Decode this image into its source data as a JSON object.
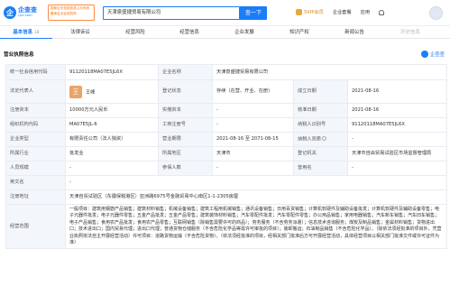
{
  "header": {
    "logo_mark": "企",
    "logo_text": "企查查",
    "logo_sub": "Qcc.com",
    "official_badge": "国家企业信用信息公示系统 备案企业征信机构",
    "search_value": "天津泉盛捷贸易有限公司",
    "search_button": "查一下",
    "links": {
      "svip": "SVIP会员",
      "enterprise": "企业套餐",
      "app": "应用",
      "notifications": ""
    }
  },
  "tabs": [
    {
      "label": "基本信息",
      "count": "18",
      "active": true
    },
    {
      "label": "法律诉讼",
      "count": "",
      "active": false
    },
    {
      "label": "经营风险",
      "count": "",
      "active": false
    },
    {
      "label": "经营信息",
      "count": "",
      "active": false
    },
    {
      "label": "企业发展",
      "count": "",
      "active": false
    },
    {
      "label": "知识产权",
      "count": "",
      "active": false
    },
    {
      "label": "新闻公告",
      "count": "",
      "active": false
    },
    {
      "label": "历史信息",
      "count": "",
      "active": false
    }
  ],
  "section": {
    "title": "营业执照信息",
    "source": "企查查"
  },
  "info": {
    "credit_code_label": "统一社会信用代码",
    "credit_code": "91120118MA07E5JL6X",
    "company_name_label": "企业名称",
    "company_name": "天津泉盛捷贸易有限公司",
    "legal_rep_label": "法定代表人",
    "legal_rep_avatar": "王",
    "legal_rep": "王峰",
    "status_label": "登记状态",
    "status": "存续（在营、开业、在册）",
    "established_label": "成立日期",
    "established": "2021-08-16",
    "reg_capital_label": "注册资本",
    "reg_capital": "10000万元人民币",
    "paid_capital_label": "实缴资本",
    "paid_capital": "-",
    "approval_date_label": "核准日期",
    "approval_date": "2021-08-16",
    "org_code_label": "组织机构代码",
    "org_code": "MA07E5JL-6",
    "biz_reg_no_label": "工商注册号",
    "biz_reg_no": "-",
    "taxpayer_id_label": "纳税人识别号",
    "taxpayer_id": "91120118MA07E5JL6X",
    "company_type_label": "企业类型",
    "company_type": "有限责任公司（法人独资）",
    "biz_term_label": "营业期限",
    "biz_term": "2021-08-16 至 2071-08-15",
    "taxpayer_qual_label": "纳税人资质",
    "taxpayer_qual": "-",
    "industry_label": "所属行业",
    "industry": "批发业",
    "region_label": "所属地区",
    "region": "天津市",
    "authority_label": "登记机关",
    "authority": "天津市自由贸易试验区市场监督管理局",
    "staff_label": "人员规模",
    "staff": "-",
    "insured_label": "参保人数",
    "insured": "-",
    "former_name_label": "曾用名",
    "former_name": "-",
    "english_name_label": "英文名",
    "english_name": "-",
    "address_label": "注册地址",
    "address": "天津自贸试验区（东疆保税港区）亚洲路6975号金融贸易中心南区1-1-2305房屋",
    "scope_label": "经营范围",
    "scope": "一般项目：建筑用钢筋产品销售；建筑材料销售；机械设备销售；建筑工程用机械销售；通讯设备销售；日用百货销售；计算机软硬件及辅助设备批发；计算机软硬件及辅助设备零售；电子元器件批发；电子元器件零售；五金产品批发；五金产品零售；建筑装饰材料销售；汽车零配件批发；汽车零配件零售；办公用品销售；家用电器销售；汽车新车销售；汽车旧车销售；电子产品销售；食用农产品批发；食用农产品零售；互联网销售（除销售需要许可的商品）；劳务服务（不含劳务派遣）；信息技术咨询服务；煤炭及制品销售；金属材料销售；货物进出口；技术进出口；国内贸易代理；进出口代理；普通货物仓储服务（不含危险化学品等需许可审批的项目）；装卸搬运；石油制品销售（不含危险化学品）。（除依法须经批准的项目外，凭营业执照依法自主开展经营活动）许可项目：道路货物运输（不含危险货物）。（依法须经批准的项目，经相关部门批准后方可开展经营活动，具体经营项目以相关部门批准文件或许可证件为准）"
  }
}
